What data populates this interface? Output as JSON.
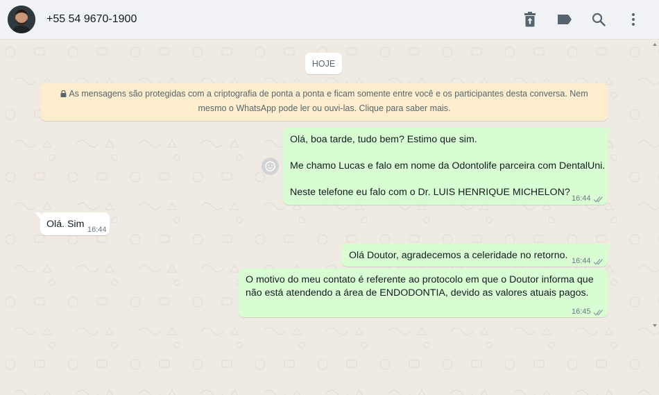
{
  "header": {
    "contact_name": "+55 54 9670-1900",
    "icons": [
      "delete-icon",
      "label-icon",
      "search-icon",
      "menu-icon"
    ]
  },
  "chat": {
    "date_chip": "HOJE",
    "encryption_notice": {
      "line1": "As mensagens são protegidas com a criptografia de ponta a ponta e ficam somente entre você e os participantes desta conversa. Nem",
      "line2": "mesmo o WhatsApp pode ler ou ouvi-las. Clique para saber mais."
    },
    "messages": [
      {
        "direction": "out",
        "lines": [
          "Olá, boa tarde, tudo bem? Estimo que sim.",
          "Me chamo Lucas e falo em nome da Odontolife parceira com DentalUni.",
          "Neste telefone eu falo com o Dr. LUIS HENRIQUE MICHELON?"
        ],
        "time": "16:44"
      },
      {
        "direction": "in",
        "lines": [
          "Olá. Sim"
        ],
        "time": "16:44"
      },
      {
        "direction": "out",
        "lines": [
          "Olá Doutor, agradecemos a celeridade no retorno."
        ],
        "time": "16:44"
      },
      {
        "direction": "out",
        "lines": [
          "O motivo do meu contato é referente ao protocolo em que o Doutor informa que",
          "não está atendendo a área de ENDODONTIA, devido as valores atuais pagos."
        ],
        "time": "16:45"
      }
    ]
  },
  "colors": {
    "header_bg": "#f0f2f5",
    "chat_bg": "#efeae2",
    "outgoing_bubble": "#d9fdd3",
    "incoming_bubble": "#ffffff",
    "notice_bg": "#ffeecd",
    "icon": "#54656f",
    "read_ticks": "#8696a0"
  }
}
